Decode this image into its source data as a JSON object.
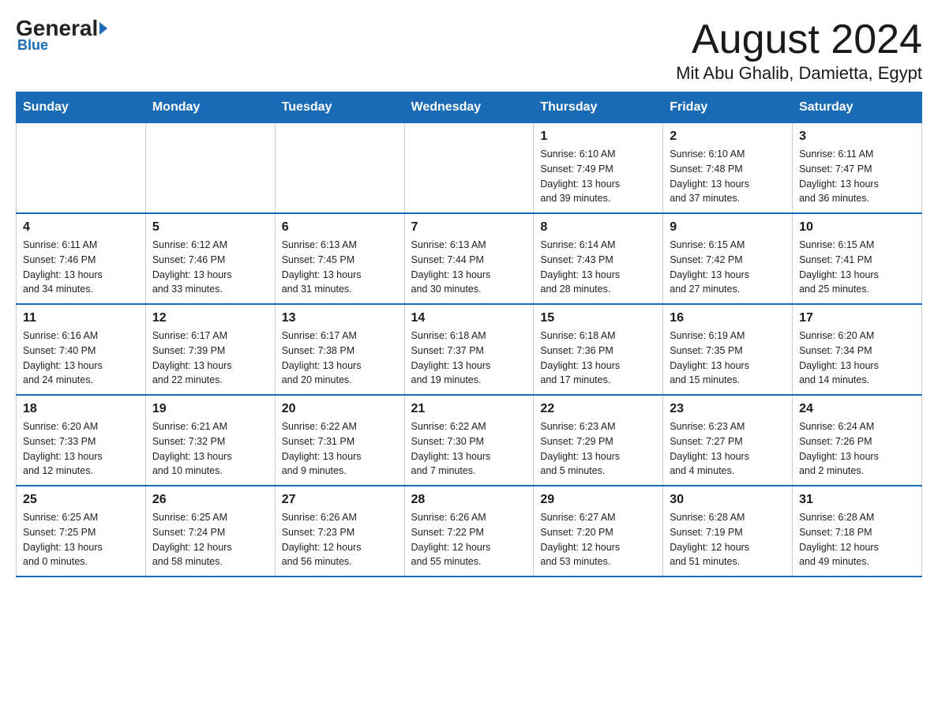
{
  "logo": {
    "general": "General",
    "blue": "Blue"
  },
  "title": "August 2024",
  "subtitle": "Mit Abu Ghalib, Damietta, Egypt",
  "days_header": [
    "Sunday",
    "Monday",
    "Tuesday",
    "Wednesday",
    "Thursday",
    "Friday",
    "Saturday"
  ],
  "weeks": [
    [
      {
        "day": "",
        "info": ""
      },
      {
        "day": "",
        "info": ""
      },
      {
        "day": "",
        "info": ""
      },
      {
        "day": "",
        "info": ""
      },
      {
        "day": "1",
        "info": "Sunrise: 6:10 AM\nSunset: 7:49 PM\nDaylight: 13 hours\nand 39 minutes."
      },
      {
        "day": "2",
        "info": "Sunrise: 6:10 AM\nSunset: 7:48 PM\nDaylight: 13 hours\nand 37 minutes."
      },
      {
        "day": "3",
        "info": "Sunrise: 6:11 AM\nSunset: 7:47 PM\nDaylight: 13 hours\nand 36 minutes."
      }
    ],
    [
      {
        "day": "4",
        "info": "Sunrise: 6:11 AM\nSunset: 7:46 PM\nDaylight: 13 hours\nand 34 minutes."
      },
      {
        "day": "5",
        "info": "Sunrise: 6:12 AM\nSunset: 7:46 PM\nDaylight: 13 hours\nand 33 minutes."
      },
      {
        "day": "6",
        "info": "Sunrise: 6:13 AM\nSunset: 7:45 PM\nDaylight: 13 hours\nand 31 minutes."
      },
      {
        "day": "7",
        "info": "Sunrise: 6:13 AM\nSunset: 7:44 PM\nDaylight: 13 hours\nand 30 minutes."
      },
      {
        "day": "8",
        "info": "Sunrise: 6:14 AM\nSunset: 7:43 PM\nDaylight: 13 hours\nand 28 minutes."
      },
      {
        "day": "9",
        "info": "Sunrise: 6:15 AM\nSunset: 7:42 PM\nDaylight: 13 hours\nand 27 minutes."
      },
      {
        "day": "10",
        "info": "Sunrise: 6:15 AM\nSunset: 7:41 PM\nDaylight: 13 hours\nand 25 minutes."
      }
    ],
    [
      {
        "day": "11",
        "info": "Sunrise: 6:16 AM\nSunset: 7:40 PM\nDaylight: 13 hours\nand 24 minutes."
      },
      {
        "day": "12",
        "info": "Sunrise: 6:17 AM\nSunset: 7:39 PM\nDaylight: 13 hours\nand 22 minutes."
      },
      {
        "day": "13",
        "info": "Sunrise: 6:17 AM\nSunset: 7:38 PM\nDaylight: 13 hours\nand 20 minutes."
      },
      {
        "day": "14",
        "info": "Sunrise: 6:18 AM\nSunset: 7:37 PM\nDaylight: 13 hours\nand 19 minutes."
      },
      {
        "day": "15",
        "info": "Sunrise: 6:18 AM\nSunset: 7:36 PM\nDaylight: 13 hours\nand 17 minutes."
      },
      {
        "day": "16",
        "info": "Sunrise: 6:19 AM\nSunset: 7:35 PM\nDaylight: 13 hours\nand 15 minutes."
      },
      {
        "day": "17",
        "info": "Sunrise: 6:20 AM\nSunset: 7:34 PM\nDaylight: 13 hours\nand 14 minutes."
      }
    ],
    [
      {
        "day": "18",
        "info": "Sunrise: 6:20 AM\nSunset: 7:33 PM\nDaylight: 13 hours\nand 12 minutes."
      },
      {
        "day": "19",
        "info": "Sunrise: 6:21 AM\nSunset: 7:32 PM\nDaylight: 13 hours\nand 10 minutes."
      },
      {
        "day": "20",
        "info": "Sunrise: 6:22 AM\nSunset: 7:31 PM\nDaylight: 13 hours\nand 9 minutes."
      },
      {
        "day": "21",
        "info": "Sunrise: 6:22 AM\nSunset: 7:30 PM\nDaylight: 13 hours\nand 7 minutes."
      },
      {
        "day": "22",
        "info": "Sunrise: 6:23 AM\nSunset: 7:29 PM\nDaylight: 13 hours\nand 5 minutes."
      },
      {
        "day": "23",
        "info": "Sunrise: 6:23 AM\nSunset: 7:27 PM\nDaylight: 13 hours\nand 4 minutes."
      },
      {
        "day": "24",
        "info": "Sunrise: 6:24 AM\nSunset: 7:26 PM\nDaylight: 13 hours\nand 2 minutes."
      }
    ],
    [
      {
        "day": "25",
        "info": "Sunrise: 6:25 AM\nSunset: 7:25 PM\nDaylight: 13 hours\nand 0 minutes."
      },
      {
        "day": "26",
        "info": "Sunrise: 6:25 AM\nSunset: 7:24 PM\nDaylight: 12 hours\nand 58 minutes."
      },
      {
        "day": "27",
        "info": "Sunrise: 6:26 AM\nSunset: 7:23 PM\nDaylight: 12 hours\nand 56 minutes."
      },
      {
        "day": "28",
        "info": "Sunrise: 6:26 AM\nSunset: 7:22 PM\nDaylight: 12 hours\nand 55 minutes."
      },
      {
        "day": "29",
        "info": "Sunrise: 6:27 AM\nSunset: 7:20 PM\nDaylight: 12 hours\nand 53 minutes."
      },
      {
        "day": "30",
        "info": "Sunrise: 6:28 AM\nSunset: 7:19 PM\nDaylight: 12 hours\nand 51 minutes."
      },
      {
        "day": "31",
        "info": "Sunrise: 6:28 AM\nSunset: 7:18 PM\nDaylight: 12 hours\nand 49 minutes."
      }
    ]
  ]
}
